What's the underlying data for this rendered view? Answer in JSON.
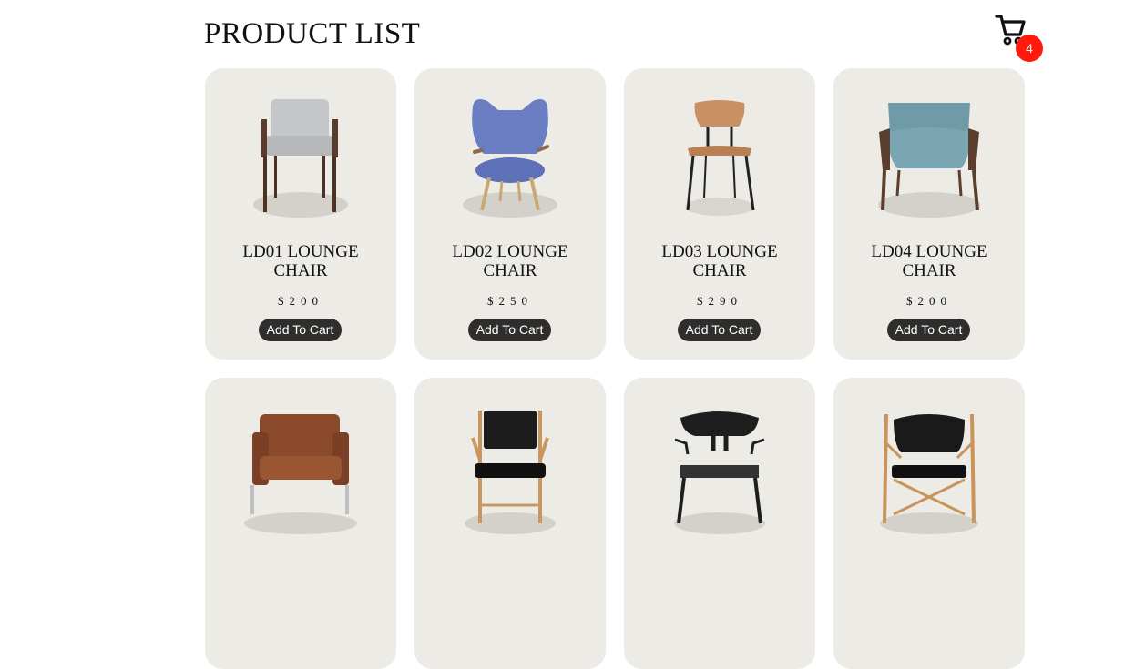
{
  "header": {
    "title": "PRODUCT LIST",
    "cart_count": "4"
  },
  "products": [
    {
      "name": "LD01 LOUNGE CHAIR",
      "price": "$200",
      "button": "Add To Cart",
      "icon": "grey-armchair-icon"
    },
    {
      "name": "LD02 LOUNGE CHAIR",
      "price": "$250",
      "button": "Add To Cart",
      "icon": "blue-wingback-chair-icon"
    },
    {
      "name": "LD03 LOUNGE CHAIR",
      "price": "$290",
      "button": "Add To Cart",
      "icon": "wooden-side-chair-icon"
    },
    {
      "name": "LD04 LOUNGE CHAIR",
      "price": "$200",
      "button": "Add To Cart",
      "icon": "teal-easy-chair-icon"
    },
    {
      "name": "",
      "price": "",
      "button": "",
      "icon": "brown-leather-lounge-chair-icon"
    },
    {
      "name": "",
      "price": "",
      "button": "",
      "icon": "black-canvas-armchair-icon"
    },
    {
      "name": "",
      "price": "",
      "button": "",
      "icon": "black-round-back-chair-icon"
    },
    {
      "name": "",
      "price": "",
      "button": "",
      "icon": "black-sawbuck-chair-icon"
    }
  ]
}
